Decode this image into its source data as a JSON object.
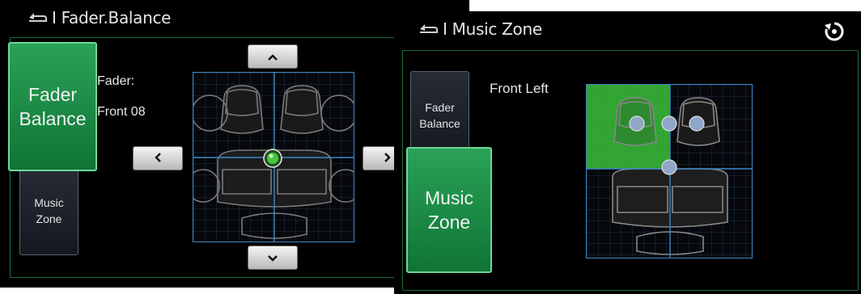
{
  "fader_screen": {
    "title": "I Fader.Balance",
    "side_buttons": {
      "fader_balance": "Fader\nBalance",
      "music_zone": "Music\nZone"
    },
    "readout_label": "Fader:",
    "readout_value": "Front 08",
    "arrows": {
      "up": "⌃",
      "down": "⌄",
      "left": "‹",
      "right": "›"
    },
    "colors": {
      "accent_green": "#1e8e47",
      "grid_line": "#3e88c6"
    }
  },
  "music_screen": {
    "title": "I Music Zone",
    "side_buttons": {
      "fader_balance": "Fader\nBalance",
      "music_zone": "Music\nZone"
    },
    "zone_label": "Front Left",
    "selected_zone": "front-left",
    "colors": {
      "zone_highlight": "#3bbf3b"
    }
  }
}
